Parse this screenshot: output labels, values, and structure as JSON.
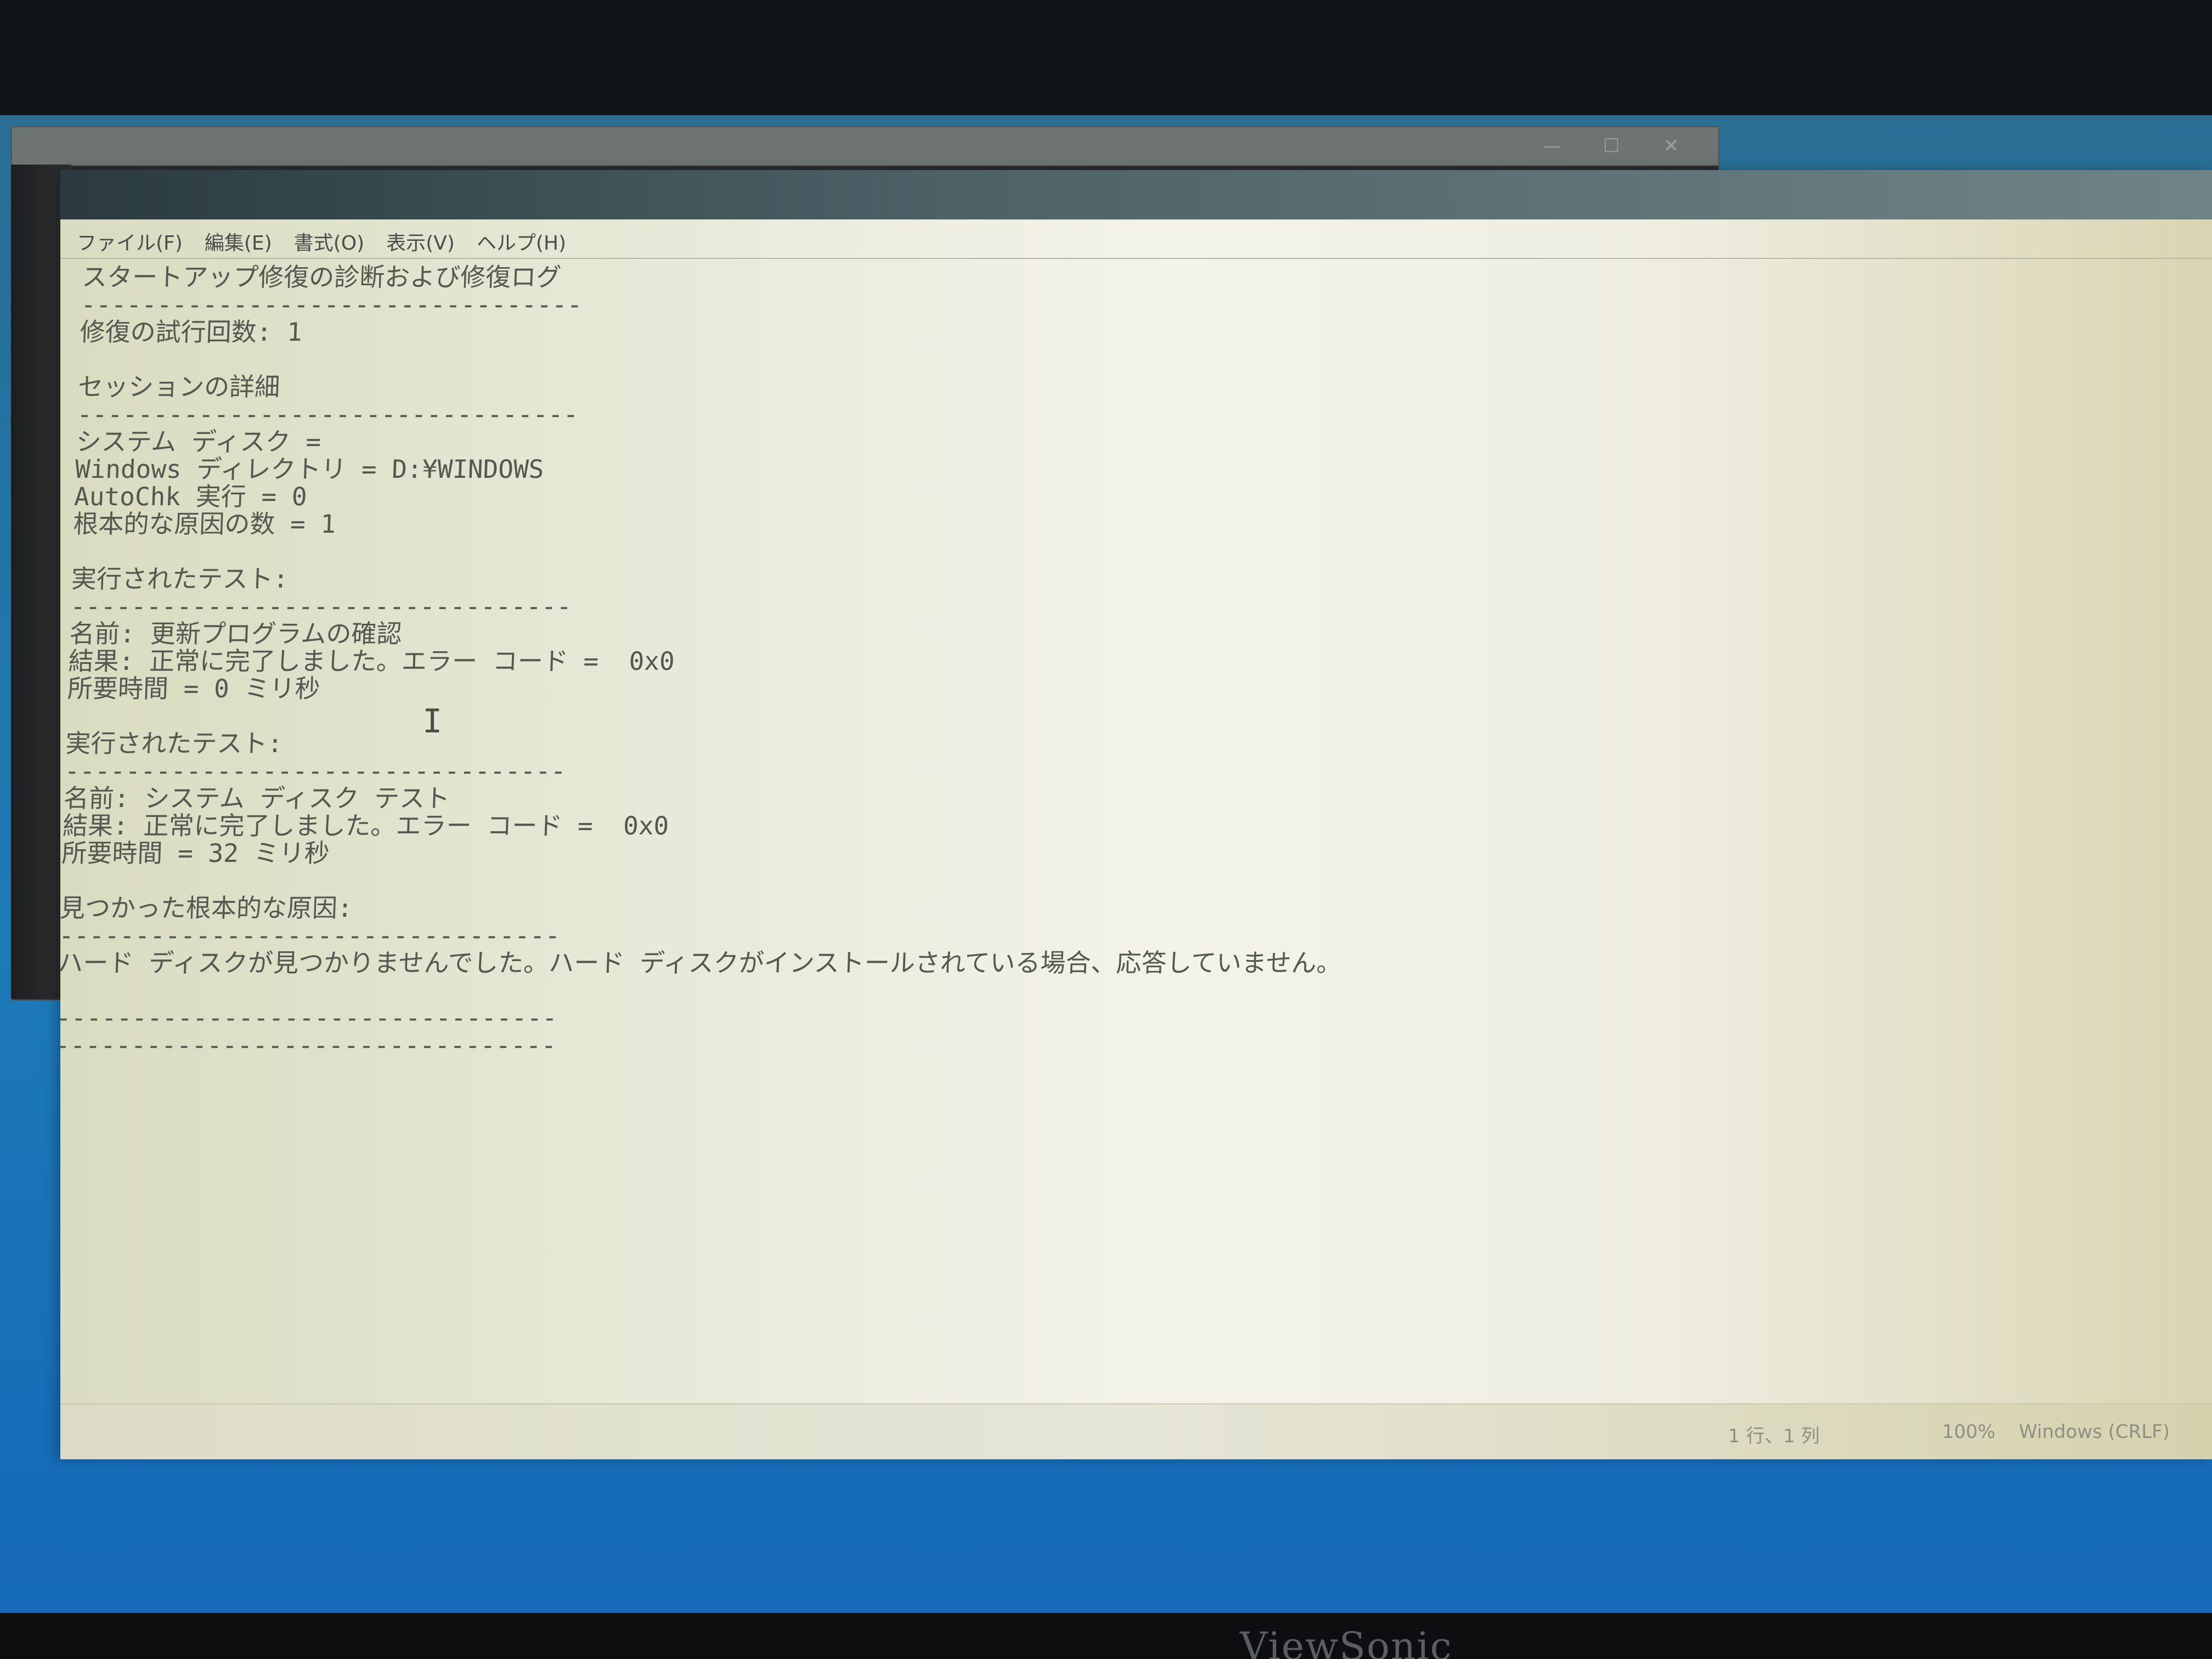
{
  "notepad": {
    "menu": [
      "ファイル(F)",
      "編集(E)",
      "書式(O)",
      "表示(V)",
      "ヘルプ(H)"
    ],
    "lines": [
      "スタートアップ修復の診断および修復ログ",
      "---------------------------------",
      "修復の試行回数: 1",
      "",
      "セッションの詳細",
      "---------------------------------",
      "システム ディスク =",
      "Windows ディレクトリ = D:¥WINDOWS",
      "AutoChk 実行 = 0",
      "根本的な原因の数 = 1",
      "",
      "実行されたテスト:",
      "---------------------------------",
      "名前: 更新プログラムの確認",
      "結果: 正常に完了しました。エラー コード =  0x0",
      "所要時間 = 0 ミリ秒",
      "",
      "実行されたテスト:",
      "---------------------------------",
      "名前: システム ディスク テスト",
      "結果: 正常に完了しました。エラー コード =  0x0",
      "所要時間 = 32 ミリ秒",
      "",
      "見つかった根本的な原因:",
      "---------------------------------",
      "ハード ディスクが見つかりませんでした。ハード ディスクがインストールされている場合、応答していません。",
      "",
      "---------------------------------",
      "---------------------------------"
    ],
    "status": {
      "position": "1 行、1 列",
      "zoom": "100%",
      "encoding": "Windows (CRLF)"
    }
  },
  "monitor": {
    "brand": "ViewSonic"
  }
}
